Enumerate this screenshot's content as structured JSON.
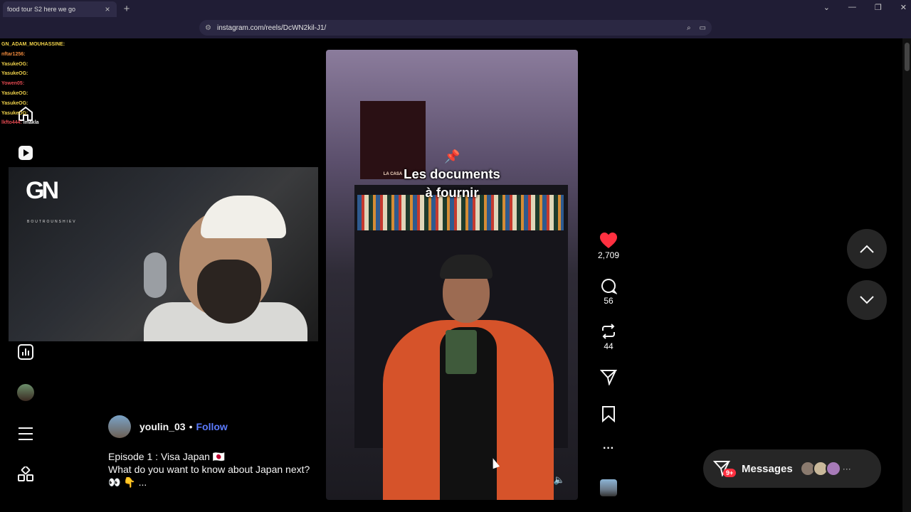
{
  "browser": {
    "tab_title": "food tour S2 here we go",
    "tab_site": "Instagram",
    "new_tab": "+",
    "tab_close": "×",
    "url": "instagram.com/reels/DcWN2kil-J1/",
    "window_controls": [
      "⌄",
      "—",
      "❐",
      "✕"
    ]
  },
  "chat": [
    {
      "user": "GN_ADAM_MOUHASSINE:",
      "text": ""
    },
    {
      "user": "nftar1256:",
      "text": ""
    },
    {
      "user": "YasukeOG:",
      "text": ""
    },
    {
      "user": "YasukeOG:",
      "text": ""
    },
    {
      "user": "Yowen05:",
      "text": ""
    },
    {
      "user": "YasukeOG:",
      "text": ""
    },
    {
      "user": "YasukeOG:",
      "text": ""
    },
    {
      "user": "YasukeOG:",
      "text": ""
    },
    {
      "user": "lkfto444:",
      "text": "lmakla"
    }
  ],
  "stream": {
    "logo": "GN",
    "logo_sub": "BOUTROUNSHIEV"
  },
  "reel": {
    "overlay_line1": "Les documents",
    "overlay_line2": "à fournir",
    "poster_label": "LA CASA",
    "author": "youlin_03",
    "separator": "•",
    "follow": "Follow",
    "caption_line1": "Episode 1 : Visa Japan 🇯🇵",
    "caption_line2": "What do you want to know about Japan next? 👀 👇 ...",
    "likes": "2,709",
    "comments": "56",
    "reposts": "44"
  },
  "messages": {
    "label": "Messages",
    "badge": "9+",
    "more": "···"
  },
  "colors": {
    "accent": "#5b7bff",
    "like": "#ff3040",
    "bg": "#000000"
  }
}
